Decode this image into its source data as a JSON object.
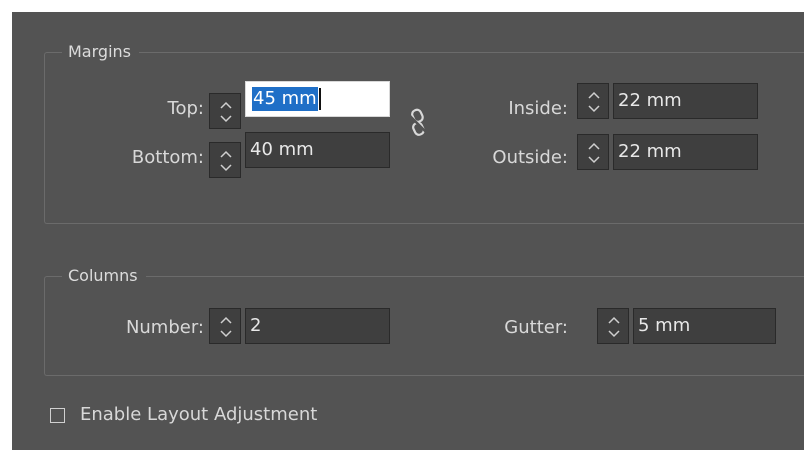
{
  "margins": {
    "legend": "Margins",
    "top": {
      "label": "Top:",
      "value": "45 mm"
    },
    "bottom": {
      "label": "Bottom:",
      "value": "40 mm"
    },
    "inside": {
      "label": "Inside:",
      "value": "22 mm"
    },
    "outside": {
      "label": "Outside:",
      "value": "22 mm"
    },
    "link_icon": "broken-chain-link-icon"
  },
  "columns": {
    "legend": "Columns",
    "number": {
      "label": "Number:",
      "value": "2"
    },
    "gutter": {
      "label": "Gutter:",
      "value": "5 mm"
    }
  },
  "layout_adjustment": {
    "label": "Enable Layout Adjustment",
    "checked": false
  },
  "colors": {
    "panel_bg": "#535353",
    "field_bg": "#3f3f3f",
    "selection": "#1f6fc7",
    "text": "#d8d8d8"
  }
}
